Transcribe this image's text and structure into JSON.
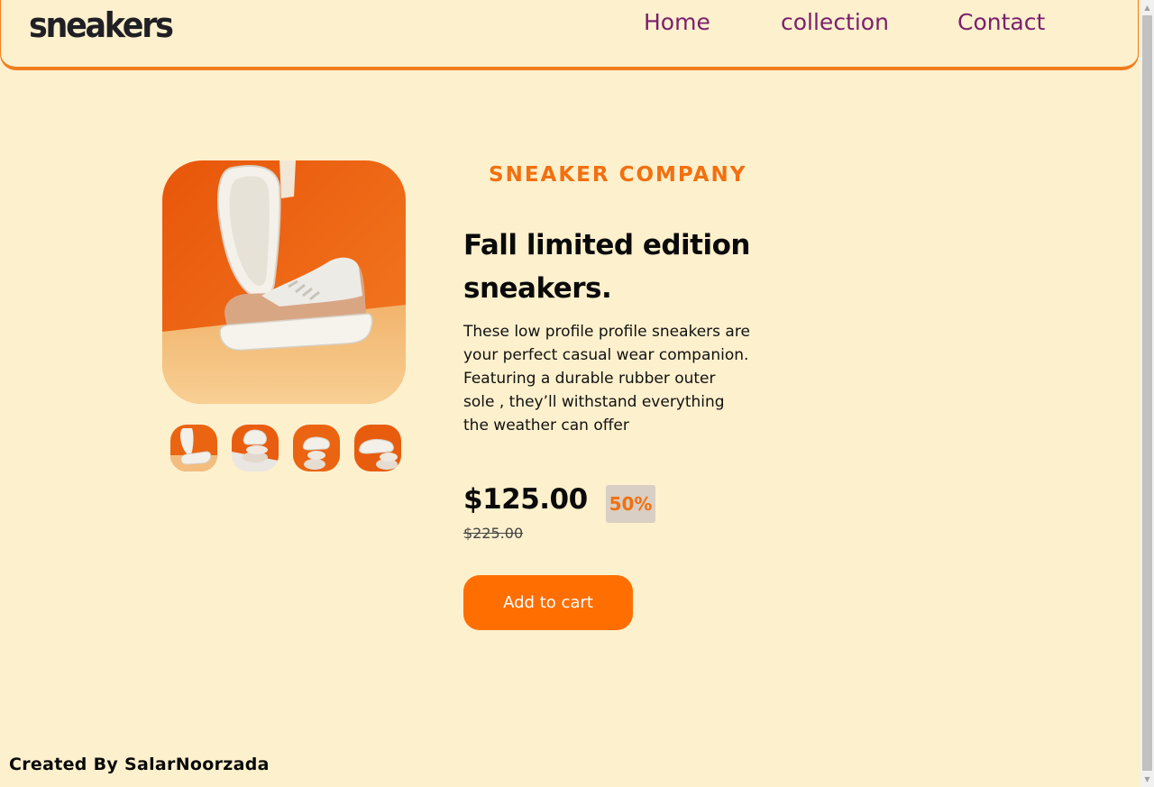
{
  "header": {
    "logo": "sneakers",
    "nav": {
      "home": "Home",
      "collection": "collection",
      "contact": "Contact"
    }
  },
  "gallery": {
    "main_image_alt": "sneaker-main-image",
    "thumbnails": [
      "thumbnail-1",
      "thumbnail-2",
      "thumbnail-3",
      "thumbnail-4"
    ]
  },
  "product": {
    "company": "SNEAKER COMPANY",
    "title": "Fall limited edition sneakers.",
    "description": "These low profile profile sneakers are your perfect casual wear companion. Featuring a durable rubber outer sole , they’ll withstand everything the weather can offer",
    "price": "$125.00",
    "discount": "50%",
    "old_price": "$225.00",
    "add_to_cart": "Add to cart"
  },
  "footer": {
    "credit": "Created By SalarNoorzada"
  },
  "colors": {
    "background": "#fdf0cd",
    "accent": "#ff6e00",
    "nav_link": "#7a1f6c"
  },
  "icons": {
    "scroll_up": "scroll-up-arrow-icon",
    "scroll_down": "scroll-down-arrow-icon"
  }
}
